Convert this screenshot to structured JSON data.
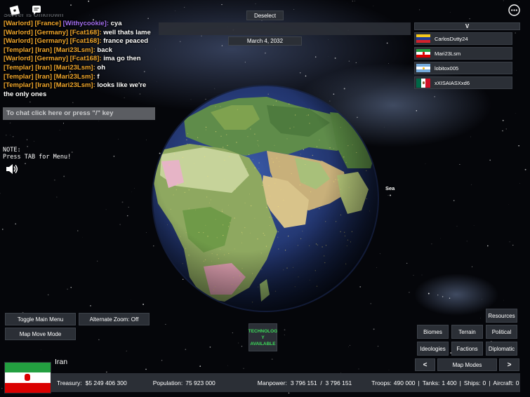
{
  "top_icons": {
    "roblox": "roblox-logo-icon",
    "chat": "chat-icon",
    "menu": "more-options-icon"
  },
  "buttons": {
    "deselect": "Deselect",
    "v_toggle": "V",
    "toggle_main_menu": "Toggle Main Menu",
    "alternate_zoom": "Alternate Zoom: Off",
    "map_move_mode": "Map Move Mode",
    "technology_available": "TECHNOLOG Y AVAILABLE",
    "resources": "Resources",
    "biomes": "Biomes",
    "terrain": "Terrain",
    "political": "Political",
    "ideologies": "Ideologies",
    "factions": "Factions",
    "diplomatic": "Diplomatic",
    "prev": "<",
    "map_modes": "Map Modes",
    "next": ">"
  },
  "date": "March 4, 2032",
  "chat": {
    "partial_top": "Server is Unknown",
    "placeholder": "To chat click here or press \"/\" key",
    "lines": [
      {
        "rank": "[Warlord]",
        "country": "[France]",
        "user": "[Withycookie]:",
        "user_color": "#a36ef0",
        "message": "cya"
      },
      {
        "rank": "[Warlord]",
        "country": "[Germany]",
        "user": "[Fcat168]:",
        "user_color": "#f0a62b",
        "message": "well thats lame"
      },
      {
        "rank": "[Warlord]",
        "country": "[Germany]",
        "user": "[Fcat168]:",
        "user_color": "#f0a62b",
        "message": "france peaced"
      },
      {
        "rank": "[Templar]",
        "country": "[Iran]",
        "user": "[Mari23Lsm]:",
        "user_color": "#f0a62b",
        "message": "back"
      },
      {
        "rank": "[Warlord]",
        "country": "[Germany]",
        "user": "[Fcat168]:",
        "user_color": "#f0a62b",
        "message": "ima go then"
      },
      {
        "rank": "[Templar]",
        "country": "[Iran]",
        "user": "[Mari23Lsm]:",
        "user_color": "#f0a62b",
        "message": "oh"
      },
      {
        "rank": "[Templar]",
        "country": "[Iran]",
        "user": "[Mari23Lsm]:",
        "user_color": "#f0a62b",
        "message": "f"
      },
      {
        "rank": "[Templar]",
        "country": "[Iran]",
        "user": "[Mari23Lsm]:",
        "user_color": "#f0a62b",
        "message": "looks like we're"
      }
    ],
    "wrap_line": "the only ones"
  },
  "note": {
    "title": "NOTE:",
    "body": "Press TAB for Menu!"
  },
  "sound_icon": "speaker-icon",
  "sea_label": "Sea",
  "players": [
    {
      "name": "CarlosDutty24",
      "flag": "venezuela-flag"
    },
    {
      "name": "Mari23Lsm",
      "flag": "iran-flag"
    },
    {
      "name": "lobitox005",
      "flag": "argentina-flag"
    },
    {
      "name": "xXISAIASXxd6",
      "flag": "mexico-flag"
    }
  ],
  "country": {
    "name": "Iran",
    "flag": "iran-flag",
    "treasury_label": "Treasury:",
    "treasury": "$5 249 406 300",
    "population_label": "Population:",
    "population": "75 923 000",
    "manpower_label": "Manpower:",
    "manpower": "3 796 151  /  3 796 151",
    "troops_label": "Troops:",
    "troops": "490 000",
    "tanks_label": "Tanks:",
    "tanks": "1 400",
    "ships_label": "Ships:",
    "ships": "0",
    "aircraft_label": "Aircraft:",
    "aircraft": "0"
  },
  "colors": {
    "panel": "#2b2f36",
    "chat_rank": "#f0a62b",
    "chat_purple": "#a36ef0",
    "tech_text": "#3ddc5a"
  }
}
